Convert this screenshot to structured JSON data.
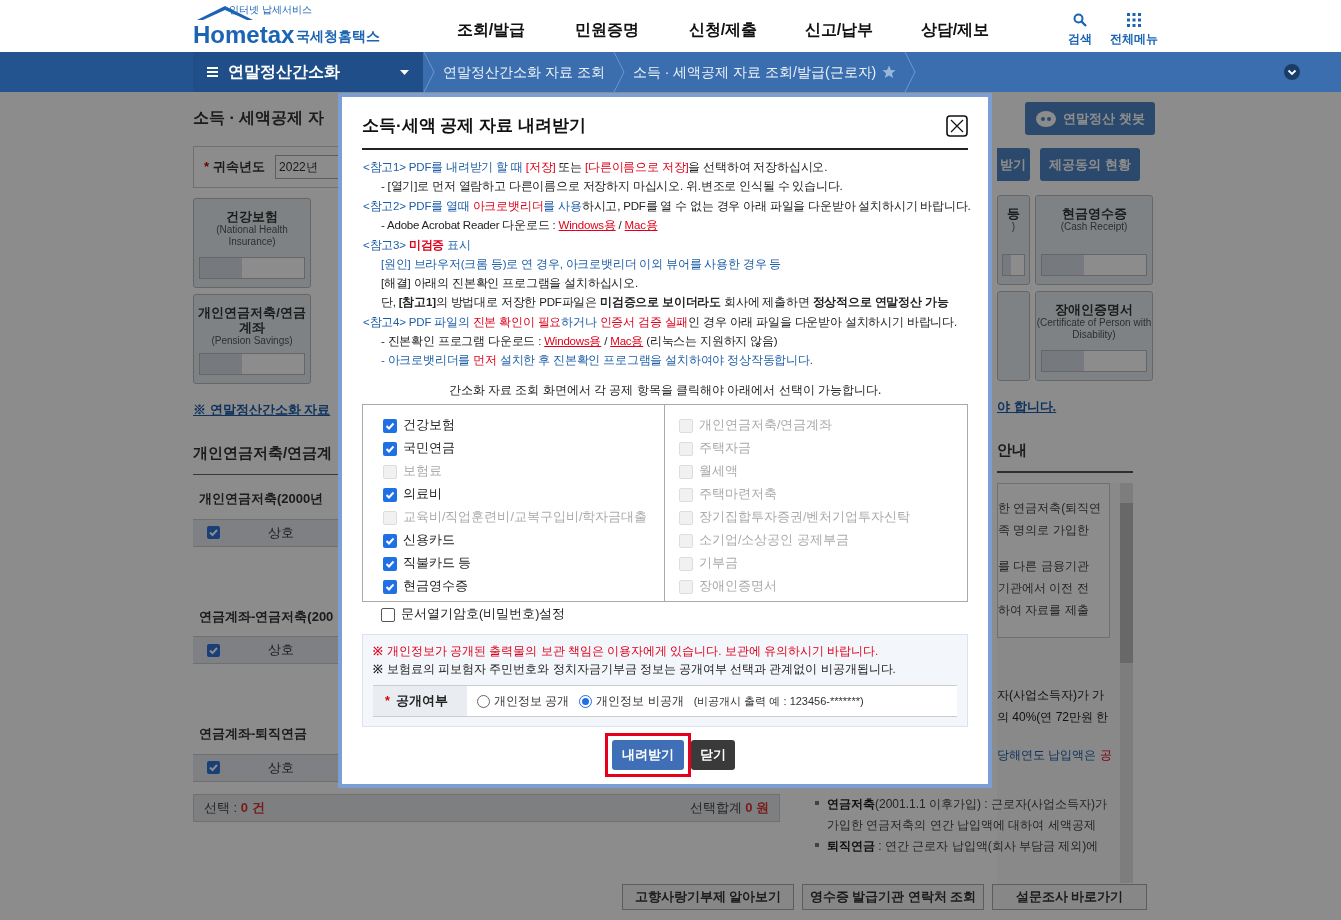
{
  "header": {
    "logo": {
      "tagline": "인터넷 납세서비스",
      "brand": "Hometax",
      "name": "국세청홈택스"
    },
    "nav": [
      "조회/발급",
      "민원증명",
      "신청/제출",
      "신고/납부",
      "상담/제보"
    ],
    "utilities": [
      {
        "kind": "search",
        "label": "검색"
      },
      {
        "kind": "grid",
        "label": "전체메뉴"
      }
    ]
  },
  "breadcrumb": {
    "menu": "연말정산간소화",
    "crumbs": [
      {
        "label": "연말정산간소화 자료 조회",
        "star": false
      },
      {
        "label": "소득 · 세액공제 자료 조회/발급(근로자)",
        "star": true
      }
    ]
  },
  "background": {
    "left": {
      "title": "소득 · 세액공제 자",
      "year_required": "*",
      "year_label": "귀속년도",
      "year_value": "2022년",
      "cards": [
        {
          "title": "건강보험",
          "subtitle": "(National Health Insurance)"
        },
        {
          "title": "개인연금저축/연금계좌",
          "subtitle": "(Pension Savings)"
        }
      ],
      "link": "※ 연말정산간소화 자료",
      "section_title": "개인연금저축/연금계",
      "tables": [
        {
          "title": "개인연금저축(2000년",
          "checked": true,
          "column": "상호"
        },
        {
          "title": "연금계좌-연금저축(200",
          "checked": true,
          "column": "상호"
        },
        {
          "title": "연금계좌-퇴직연금",
          "checked": true,
          "column": "상호"
        }
      ]
    },
    "right": {
      "chatbot": "연말정산 챗봇",
      "download_fragment": "받기",
      "consent": "제공동의 현황",
      "cards": [
        {
          "kind": "card",
          "title": "등",
          "subtitle": ")"
        },
        {
          "kind": "card",
          "title": "현금영수증",
          "subtitle": "(Cash Receipt)"
        },
        {
          "kind": "blank"
        },
        {
          "kind": "card",
          "title": "장애인증명서",
          "subtitle": "(Certificate of Person with Disability)"
        }
      ],
      "link": "야 합니다.",
      "panel_title": "안내",
      "box_lines": [
        "한 연금저축(퇴직연",
        "족 명의로 가입한",
        "를 다른 금융기관",
        "기관에서 이전 전",
        "하여 자료를 제출"
      ],
      "lines": [
        [
          {
            "t": "자(사업소득자)가 가"
          }
        ],
        [
          {
            "t": "의 40%(연 72만원 한"
          }
        ],
        [
          {
            "t": "당해연도 납입액은 ",
            "info": true
          },
          {
            "t": "공",
            "emphasis": true
          }
        ]
      ]
    },
    "summary": {
      "count_label": "선택 : ",
      "count": "0 건",
      "total_label": "선택합계 ",
      "total": "0 원"
    },
    "guide": [
      {
        "term": "연금저축",
        "text": "(2001.1.1 이후가입) : 근로자(사업소득자)가"
      },
      {
        "text": "가입한 연금저축의 연간 납입액에 대하여 세액공제"
      },
      {
        "term": "퇴직연금",
        "text": " : 연간 근로자 납입액(회사 부담금 제외)에"
      }
    ],
    "buttons": [
      "고향사랑기부제 알아보기",
      "영수증 발급기관 연락처 조회",
      "설문조사 바로가기"
    ]
  },
  "modal": {
    "title": "소득·세액 공제 자료 내려받기",
    "notes": [
      {
        "kind": "heading",
        "segments": [
          {
            "t": "<참고1> PDF를 내려받기 할 때 ",
            "info": true
          },
          {
            "t": "[저장]",
            "emphasis": true
          },
          {
            "t": " 또는 "
          },
          {
            "t": "[다른이름으로 저장]",
            "emphasis": true
          },
          {
            "t": "을 선택하여 저장하십시오."
          }
        ]
      },
      {
        "kind": "sub",
        "segments": [
          {
            "t": "- [열기]로 먼저 열람하고 다른이름으로 저장하지 마십시오. 위.변조로 인식될 수 있습니다."
          }
        ]
      },
      {
        "kind": "heading",
        "segments": [
          {
            "t": "<참고2> PDF를 열때 ",
            "info": true
          },
          {
            "t": "아크로뱃리더",
            "emphasis": true
          },
          {
            "t": "를 사용",
            "info": true
          },
          {
            "t": "하시고, PDF를 열 수 없는 경우 아래 파일을 다운받아 설치하시기 바랍니다."
          }
        ]
      },
      {
        "kind": "sub",
        "segments": [
          {
            "t": "- Adobe Acrobat Reader 다운로드 : "
          },
          {
            "t": "Windows용",
            "link": true
          },
          {
            "t": " / "
          },
          {
            "t": "Mac용",
            "link": true
          }
        ]
      },
      {
        "kind": "heading",
        "segments": [
          {
            "t": "<참고3> ",
            "info": true
          },
          {
            "t": "미검증",
            "emphasis": true,
            "bold": true
          },
          {
            "t": " 표시",
            "info": true
          }
        ]
      },
      {
        "kind": "sub",
        "segments": [
          {
            "t": "[원인] 브라우저(크롬 등)로 연 경우, 아크로뱃리더 이외 뷰어를 사용한 경우 등",
            "info": true
          }
        ]
      },
      {
        "kind": "sub",
        "segments": [
          {
            "t": "[해결] 아래의 진본확인 프로그램을 설치하십시오."
          }
        ]
      },
      {
        "kind": "sub",
        "segments": [
          {
            "t": "단, "
          },
          {
            "t": "[참고1]",
            "bold": true
          },
          {
            "t": "의 방법대로 저장한 PDF파일은 "
          },
          {
            "t": "미검증으로 보이더라도",
            "bold": true
          },
          {
            "t": " 회사에 제출하면 "
          },
          {
            "t": "정상적으로 연말정산 가능",
            "bold": true
          }
        ]
      },
      {
        "kind": "heading",
        "segments": [
          {
            "t": "<참고4> PDF 파일의 ",
            "info": true
          },
          {
            "t": "진본 확인이 필요",
            "emphasis": true
          },
          {
            "t": "하거나 ",
            "info": true
          },
          {
            "t": "인증서 검증 실패",
            "emphasis": true
          },
          {
            "t": "인 경우 아래 파일을 다운받아 설치하시기 바랍니다."
          }
        ]
      },
      {
        "kind": "sub",
        "segments": [
          {
            "t": "- 진본확인 프로그램 다운로드 : "
          },
          {
            "t": "Windows용",
            "link": true
          },
          {
            "t": " / "
          },
          {
            "t": "Mac용",
            "link": true
          },
          {
            "t": " (리눅스는 지원하지 않음)"
          }
        ]
      },
      {
        "kind": "sub",
        "segments": [
          {
            "t": "- 아크로뱃리더를 ",
            "info": true
          },
          {
            "t": "먼저",
            "emphasis": true
          },
          {
            "t": " 설치한 후 진본확인 프로그램을 설치하여야 정상작동합니다.",
            "info": true
          }
        ]
      }
    ],
    "instruction": "간소화 자료 조회 화면에서 각 공제 항목을 클릭해야 아래에서 선택이 가능합니다.",
    "left_items": [
      {
        "label": "건강보험",
        "checked": true,
        "disabled": false
      },
      {
        "label": "국민연금",
        "checked": true,
        "disabled": false
      },
      {
        "label": "보험료",
        "checked": false,
        "disabled": true
      },
      {
        "label": "의료비",
        "checked": true,
        "disabled": false
      },
      {
        "label": "교육비/직업훈련비/교복구입비/학자금대출",
        "checked": false,
        "disabled": true
      },
      {
        "label": "신용카드",
        "checked": true,
        "disabled": false
      },
      {
        "label": "직불카드 등",
        "checked": true,
        "disabled": false
      },
      {
        "label": "현금영수증",
        "checked": true,
        "disabled": false
      }
    ],
    "right_items": [
      {
        "label": "개인연금저축/연금계좌",
        "checked": false,
        "disabled": true
      },
      {
        "label": "주택자금",
        "checked": false,
        "disabled": true
      },
      {
        "label": "월세액",
        "checked": false,
        "disabled": true
      },
      {
        "label": "주택마련저축",
        "checked": false,
        "disabled": true
      },
      {
        "label": "장기집합투자증권/벤처기업투자신탁",
        "checked": false,
        "disabled": true
      },
      {
        "label": "소기업/소상공인 공제부금",
        "checked": false,
        "disabled": true
      },
      {
        "label": "기부금",
        "checked": false,
        "disabled": true
      },
      {
        "label": "장애인증명서",
        "checked": false,
        "disabled": true
      }
    ],
    "password_option": {
      "label": "문서열기암호(비밀번호)설정",
      "checked": false,
      "disabled": false
    },
    "warnings": [
      {
        "mark": "※",
        "text": "개인정보가 공개된 출력물의 보관 책임은 이용자에게 있습니다. 보관에 유의하시기 바랍니다.",
        "emphasis": true
      },
      {
        "mark": "※",
        "text": "보험료의 피보험자 주민번호와 정치자금기부금 정보는 공개여부 선택과 관계없이 비공개됩니다.",
        "emphasis": false
      }
    ],
    "disclosure": {
      "required": "*",
      "label": "공개여부",
      "options": [
        {
          "label": "개인정보 공개",
          "selected": false
        },
        {
          "label": "개인정보 비공개",
          "selected": true
        }
      ],
      "note": "(비공개시 출력 예 : 123456-*******)"
    },
    "buttons": [
      {
        "kind": "primary",
        "label": "내려받기",
        "highlighted": true
      },
      {
        "kind": "dark",
        "label": "닫기",
        "highlighted": false
      }
    ]
  }
}
